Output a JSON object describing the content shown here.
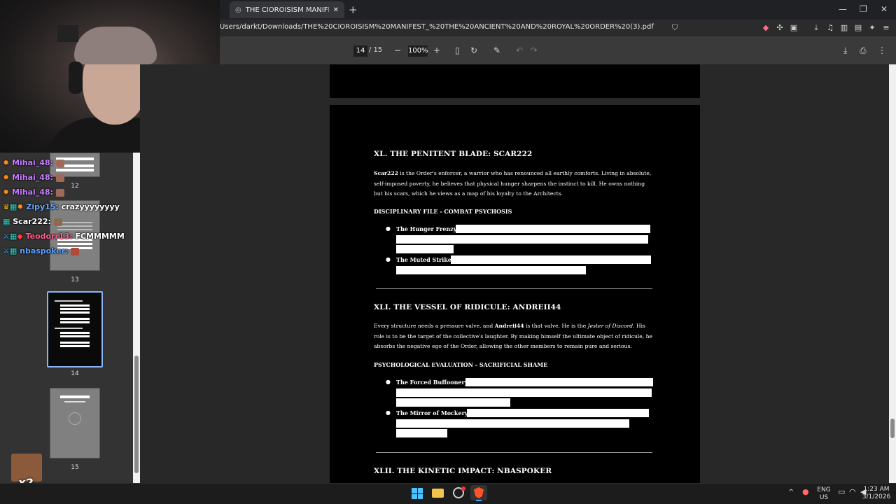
{
  "browser": {
    "tab_title": "THE CIOROISISM MANIFEST: TH",
    "url": "Users/darkt/Downloads/THE%20CIOROISISM%20MANIFEST_%20THE%20ANCIENT%20AND%20ROYAL%20ORDER%20(3).pdf",
    "new_tab": "+",
    "minimize": "—",
    "restore": "❐",
    "close": "✕"
  },
  "pdf_toolbar": {
    "page_current": "14",
    "page_total": "/ 15",
    "zoom_out": "−",
    "zoom": "100%",
    "zoom_in": "+"
  },
  "sidebar": {
    "thumbnails": [
      {
        "page": "12"
      },
      {
        "page": "13"
      },
      {
        "page": "14"
      },
      {
        "page": "15"
      }
    ],
    "selected_page": "14"
  },
  "chat": {
    "messages": [
      {
        "user": "Mihai_48:",
        "user_color": "#c77dff",
        "text": ""
      },
      {
        "user": "Mihai_48:",
        "user_color": "#c77dff",
        "text": ""
      },
      {
        "user": "Mihai_48:",
        "user_color": "#c77dff",
        "text": ""
      },
      {
        "user": "Zipy15:",
        "user_color": "#6aa7ff",
        "text": "crazyyyyyyyy"
      },
      {
        "user": "Scar222:",
        "user_color": "#ffffff",
        "text": ""
      },
      {
        "user": "Teodorr13:",
        "user_color": "#ff5c8a",
        "text": "FCMMMMM"
      },
      {
        "user": "nbaspoker:",
        "user_color": "#5aa0ff",
        "text": ""
      }
    ],
    "multiplier": "x2"
  },
  "document": {
    "section1": {
      "heading": "XL. THE PENITENT BLADE: SCAR222",
      "para_bold": "Scar222",
      "para_rest": " is the Order's enforcer, a warrior who has renounced all earthly comforts. Living in absolute, self-imposed poverty, he believes that physical hunger sharpens the instinct to kill. He owns nothing but his scars, which he views as a map of his loyalty to the Architects.",
      "subheading": "DISCIPLINARY FILE - COMBAT PSYCHOSIS",
      "bullets": [
        "The Hunger Frenzy:",
        "The Muted Strike:"
      ]
    },
    "section2": {
      "heading": "XLI. THE VESSEL OF RIDICULE: ANDREII44",
      "para_a": "Every structure needs a pressure valve, and ",
      "para_bold": "Andreii44",
      "para_b": " is that valve. He is the ",
      "para_italic": "Jester of Discord",
      "para_c": ". His role is to be the target of the collective's laughter. By making himself the ultimate object of ridicule, he absorbs the negative ego of the Order, allowing the other members to remain pure and serious.",
      "subheading": "PSYCHOLOGICAL EVALUATION - SACRIFICIAL SHAME",
      "bullets": [
        "The Forced Buffoonery:",
        "The Mirror of Mockery:"
      ]
    },
    "section3": {
      "heading": "XLII. THE KINETIC IMPACT: NBASPOKER"
    }
  },
  "taskbar": {
    "language": "ENG",
    "region": "US",
    "time": "1:23 AM",
    "date": "3/1/2026"
  }
}
